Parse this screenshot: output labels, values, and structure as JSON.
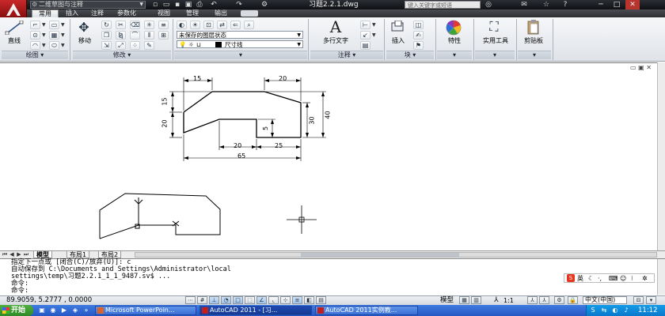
{
  "window": {
    "workspace": "二维草图与注释",
    "document_title": "习题2.2.1.dwg",
    "search_placeholder": "键入关键字或短语"
  },
  "ribbon_tabs": [
    "常用",
    "插入",
    "注释",
    "参数化",
    "视图",
    "管理",
    "输出"
  ],
  "ribbon": {
    "draw": {
      "line_label": "直线",
      "panel_label": "绘图"
    },
    "modify": {
      "move_label": "移动",
      "panel_label": "修改"
    },
    "layers": {
      "layer_state": "未保存的图层状态",
      "layer_name": "尺寸线"
    },
    "annotation": {
      "mtext_label": "多行文字",
      "panel_label": "注释"
    },
    "block": {
      "insert_label": "插入",
      "panel_label": "块"
    },
    "properties_label": "特性",
    "utilities_label": "实用工具",
    "clipboard_label": "剪贴板"
  },
  "drawing": {
    "dimensions": {
      "top_left": "15",
      "top_right": "20",
      "left_upper": "15",
      "left_lower": "20",
      "inner_height": "5",
      "right_inner": "30",
      "right_outer": "40",
      "bottom_mid": "20",
      "bottom_right": "25",
      "overall": "65"
    }
  },
  "layout_tabs": [
    "模型",
    "布局1",
    "布局2"
  ],
  "command": {
    "lines": [
      "指定下一点或 [闭合(C)/放弃(U)]: c",
      "自动保存到 C:\\Documents and Settings\\Administrator\\local",
      "settings\\temp\\习题2.2.1_1_1_9487.sv$ ...",
      "命令:",
      "命令:"
    ],
    "ime_label": "英"
  },
  "status": {
    "coords": "89.9059,  5.2777 , 0.0000",
    "model": "模型",
    "scale": "1:1",
    "language": "中文(中国)"
  },
  "taskbar": {
    "start": "开始",
    "tasks": [
      "Microsoft PowerPoin...",
      "AutoCAD 2011 - [习...",
      "AutoCAD 2011实例教..."
    ],
    "clock": "11:12"
  }
}
